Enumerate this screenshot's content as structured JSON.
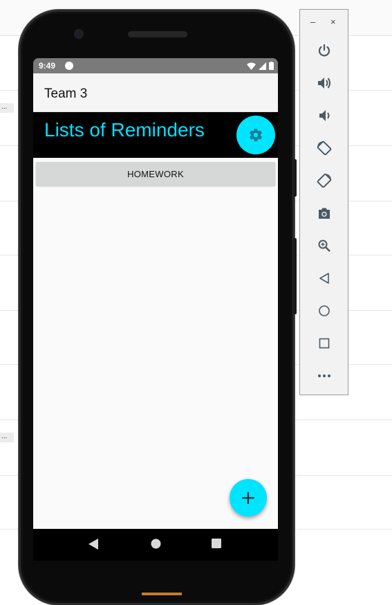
{
  "emulator": {
    "toolbar": {
      "minimize_glyph": "–",
      "close_glyph": "×",
      "buttons": [
        {
          "icon": "power-icon"
        },
        {
          "icon": "volume-up-icon"
        },
        {
          "icon": "volume-down-icon"
        },
        {
          "icon": "rotate-left-icon"
        },
        {
          "icon": "rotate-right-icon"
        },
        {
          "icon": "camera-icon"
        },
        {
          "icon": "zoom-icon"
        },
        {
          "icon": "back-icon"
        },
        {
          "icon": "home-icon"
        },
        {
          "icon": "overview-icon"
        },
        {
          "icon": "more-icon"
        }
      ]
    },
    "side_dots": [
      "...",
      "..."
    ]
  },
  "status_bar": {
    "time": "9:49"
  },
  "app_bar": {
    "title": "Team 3"
  },
  "header": {
    "title": "Lists of Reminders"
  },
  "lists": {
    "items": [
      "HOMEWORK"
    ]
  },
  "fab": {
    "add_glyph": "+"
  },
  "colors": {
    "accent": "#00e5ff",
    "header_bg": "#000000",
    "header_text": "#00e0ff",
    "list_item_bg": "#d6d7d7"
  }
}
